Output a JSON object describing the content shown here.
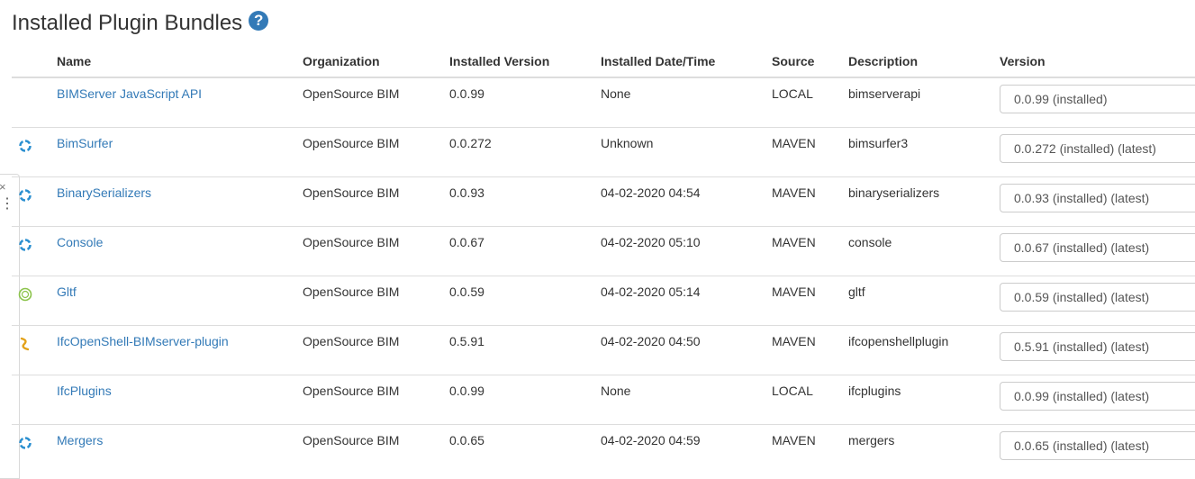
{
  "page": {
    "title": "Installed Plugin Bundles",
    "help_icon": "?"
  },
  "side_panel": {
    "close_glyph": "×",
    "dots_glyph": "⋮"
  },
  "table": {
    "headers": {
      "name": "Name",
      "organization": "Organization",
      "installed_version": "Installed Version",
      "installed_datetime": "Installed Date/Time",
      "source": "Source",
      "description": "Description",
      "version": "Version"
    },
    "rows": [
      {
        "icon": "none",
        "name": "BIMServer JavaScript API",
        "organization": "OpenSource BIM",
        "installed_version": "0.0.99",
        "installed_datetime": "None",
        "source": "LOCAL",
        "description": "bimserverapi",
        "version_selected": "0.0.99 (installed)"
      },
      {
        "icon": "bimsurfer-logo-icon",
        "name": "BimSurfer",
        "organization": "OpenSource BIM",
        "installed_version": "0.0.272",
        "installed_datetime": "Unknown",
        "source": "MAVEN",
        "description": "bimsurfer3",
        "version_selected": "0.0.272 (installed) (latest)"
      },
      {
        "icon": "opensource-bim-logo-icon",
        "name": "BinarySerializers",
        "organization": "OpenSource BIM",
        "installed_version": "0.0.93",
        "installed_datetime": "04-02-2020 04:54",
        "source": "MAVEN",
        "description": "binaryserializers",
        "version_selected": "0.0.93 (installed) (latest)"
      },
      {
        "icon": "opensource-bim-logo-icon",
        "name": "Console",
        "organization": "OpenSource BIM",
        "installed_version": "0.0.67",
        "installed_datetime": "04-02-2020 05:10",
        "source": "MAVEN",
        "description": "console",
        "version_selected": "0.0.67 (installed) (latest)"
      },
      {
        "icon": "gltf-logo-icon",
        "name": "Gltf",
        "organization": "OpenSource BIM",
        "installed_version": "0.0.59",
        "installed_datetime": "04-02-2020 05:14",
        "source": "MAVEN",
        "description": "gltf",
        "version_selected": "0.0.59 (installed) (latest)"
      },
      {
        "icon": "ifcopenshell-logo-icon",
        "name": "IfcOpenShell-BIMserver-plugin",
        "organization": "OpenSource BIM",
        "installed_version": "0.5.91",
        "installed_datetime": "04-02-2020 04:50",
        "source": "MAVEN",
        "description": "ifcopenshellplugin",
        "version_selected": "0.5.91 (installed) (latest)"
      },
      {
        "icon": "none",
        "name": "IfcPlugins",
        "organization": "OpenSource BIM",
        "installed_version": "0.0.99",
        "installed_datetime": "None",
        "source": "LOCAL",
        "description": "ifcplugins",
        "version_selected": "0.0.99 (installed) (latest)"
      },
      {
        "icon": "opensource-bim-logo-icon",
        "name": "Mergers",
        "organization": "OpenSource BIM",
        "installed_version": "0.0.65",
        "installed_datetime": "04-02-2020 04:59",
        "source": "MAVEN",
        "description": "mergers",
        "version_selected": "0.0.65 (installed) (latest)"
      }
    ]
  },
  "colors": {
    "link": "#337ab7",
    "help_icon": "#337ab7",
    "border": "#dddddd",
    "bim_logo": "#2a8fd0",
    "gltf_logo": "#8bc34a",
    "ifcopenshell_logo": "#e3a21a"
  }
}
